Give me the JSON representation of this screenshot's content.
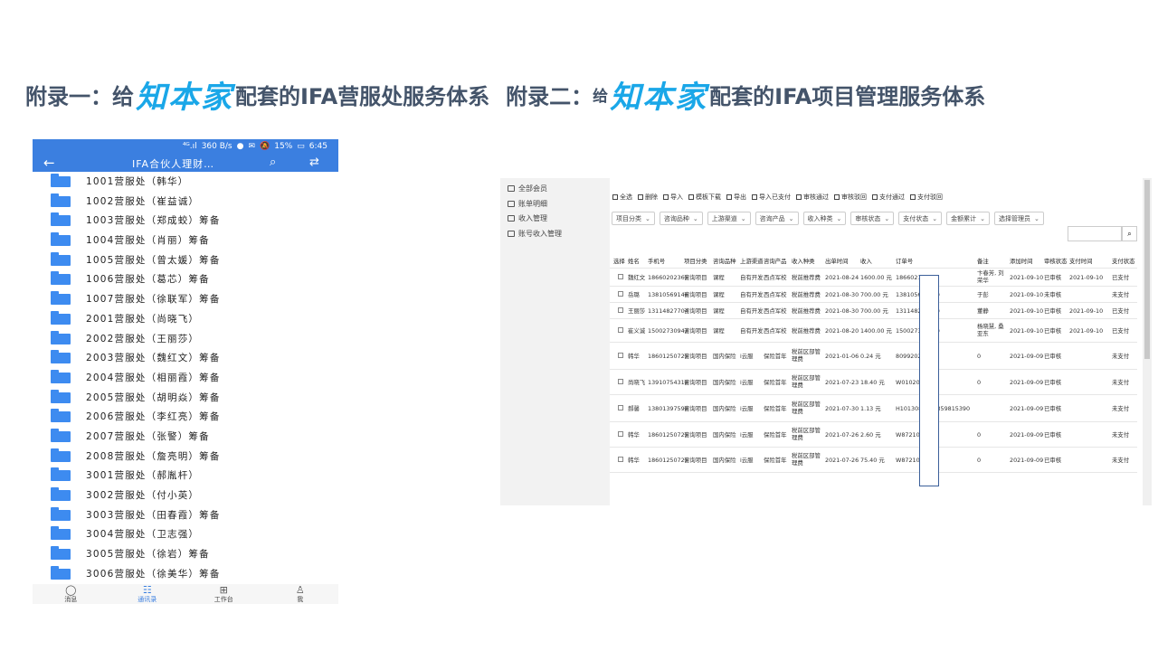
{
  "title": {
    "part1_prefix": "附录一：给",
    "brand": "知本家",
    "part1_suffix": "配套的IFA营服处服务体系",
    "part2_prefix": "附录二：",
    "part2_small": "给",
    "part2_suffix": "配套的IFA项目管理服务体系"
  },
  "colors": {
    "accent": "#3b7fe0",
    "brand": "#1aa7e8",
    "title": "#44546a",
    "folder": "#3d8bf0"
  },
  "phone": {
    "status": {
      "signal": "⁴ᴳ.ıl",
      "speed": "360 B/s",
      "battery": "15%",
      "time": "6:45"
    },
    "app_bar": {
      "title": "IFA合伙人理财…",
      "back_icon": "arrow-left-icon",
      "search_icon": "search-icon",
      "filter_icon": "filter-icon"
    },
    "folders": [
      "1001营服处（韩华）",
      "1002营服处（崔益诚）",
      "1003营服处（郑成蛟）筹备",
      "1004营服处（肖丽）筹备",
      "1005营服处（曾太媛）筹备",
      "1006营服处（葛芯）筹备",
      "1007营服处（徐联军）筹备",
      "2001营服处（尚晓飞）",
      "2002营服处（王丽莎）",
      "2003营服处（魏红文）筹备",
      "2004营服处（相丽霞）筹备",
      "2005营服处（胡明焱）筹备",
      "2006营服处（李红亮）筹备",
      "2007营服处（张警）筹备",
      "2008营服处（詹亮明）筹备",
      "3001营服处（郝胤杆）",
      "3002营服处（付小英）",
      "3003营服处（田春霞）筹备",
      "3004营服处（卫志强）",
      "3005营服处（徐岩）筹备",
      "3006营服处（徐美华）筹备"
    ],
    "nav": [
      {
        "label": "消息",
        "icon": "chat-bubble-icon",
        "active": false
      },
      {
        "label": "通讯录",
        "icon": "contacts-icon",
        "active": true
      },
      {
        "label": "工作台",
        "icon": "grid-icon",
        "active": false
      },
      {
        "label": "我",
        "icon": "person-icon",
        "active": false
      }
    ]
  },
  "desktop": {
    "sidebar": [
      "全部会员",
      "账单明细",
      "收入管理",
      "账号收入管理"
    ],
    "toolbar": [
      "全选",
      "删除",
      "导入",
      "模板下载",
      "导出",
      "导入已支付",
      "审核通过",
      "审核驳回",
      "支付通过",
      "支付驳回"
    ],
    "filters": [
      "项目分类",
      "咨询品种",
      "上游渠道",
      "咨询产品",
      "收入种类",
      "审核状态",
      "支付状态",
      "金额累计",
      "选择管理员"
    ],
    "columns": [
      "选择",
      "姓名",
      "手机号",
      "项目分类",
      "咨询品种",
      "上游渠道",
      "咨询产品",
      "收入种类",
      "出单时间",
      "收入",
      "订单号",
      "备注",
      "添加时间",
      "审核状态",
      "支付时间",
      "支付状态"
    ],
    "rows": [
      {
        "name": "魏红文",
        "phone": "18660202365",
        "cat": "咨询项目",
        "kind": "课程",
        "up": "自有开发",
        "prod": "西点军校",
        "income_type": "税前推荐费",
        "date": "2021-08-24",
        "amount": "1600.00 元",
        "order": "18660210824",
        "note": "卞春芳, 刘荣华",
        "added": "2021-09-10",
        "audit": "已审核",
        "paydate": "2021-09-10",
        "pay": "已支付"
      },
      {
        "name": "岳璐",
        "phone": "13810569146",
        "cat": "咨询项目",
        "kind": "课程",
        "up": "自有开发",
        "prod": "西点军校",
        "income_type": "税前推荐费",
        "date": "2021-08-30",
        "amount": "700.00 元",
        "order": "138105610830",
        "note": "于彭",
        "added": "2021-09-10",
        "audit": "未审核",
        "paydate": "",
        "pay": "未支付"
      },
      {
        "name": "王丽莎",
        "phone": "13114827704",
        "cat": "咨询项目",
        "kind": "课程",
        "up": "自有开发",
        "prod": "西点军校",
        "income_type": "税前推荐费",
        "date": "2021-08-30",
        "amount": "700.00 元",
        "order": "131148210830",
        "note": "董静",
        "added": "2021-09-10",
        "audit": "已审核",
        "paydate": "2021-09-10",
        "pay": "已支付"
      },
      {
        "name": "崔义诚",
        "phone": "15002730943",
        "cat": "咨询项目",
        "kind": "课程",
        "up": "自有开发",
        "prod": "西点军校",
        "income_type": "税前推荐费",
        "date": "2021-08-20",
        "amount": "1400.00 元",
        "order": "150027310820",
        "note": "杨晓慧, 桑亚东",
        "added": "2021-09-10",
        "audit": "已审核",
        "paydate": "2021-09-10",
        "pay": "已支付"
      },
      {
        "name": "韩华",
        "phone": "18601250725",
        "cat": "咨询项目",
        "kind": "国内保险",
        "up": "i云服",
        "prod": "保险首年",
        "income_type": "税前区部管理费",
        "date": "2021-01-06",
        "amount": "0.24 元",
        "order": "80992021000",
        "note": "0",
        "added": "2021-09-09",
        "audit": "已审核",
        "paydate": "",
        "pay": "未支付"
      },
      {
        "name": "尚晓飞",
        "phone": "13910754318",
        "cat": "咨询项目",
        "kind": "国内保险",
        "up": "i云服",
        "prod": "保险首年",
        "income_type": "税前区部管理费",
        "date": "2021-07-23",
        "amount": "18.40 元",
        "order": "W010209924",
        "note": "0",
        "added": "2021-09-09",
        "audit": "已审核",
        "paydate": "",
        "pay": "未支付"
      },
      {
        "name": "郝馨",
        "phone": "13801397598",
        "cat": "咨询项目",
        "kind": "国内保险",
        "up": "i云服",
        "prod": "保险首年",
        "income_type": "税前区部管理费",
        "date": "2021-07-30",
        "amount": "1.13 元",
        "order": "H1013082021359815390",
        "note": "",
        "added": "2021-09-09",
        "audit": "已审核",
        "paydate": "",
        "pay": "未支付"
      },
      {
        "name": "韩华",
        "phone": "18601250725",
        "cat": "咨询项目",
        "kind": "国内保险",
        "up": "i云服",
        "prod": "保险首年",
        "income_type": "税前区部管理费",
        "date": "2021-07-26",
        "amount": "2.60 元",
        "order": "W8721059",
        "note": "0",
        "added": "2021-09-09",
        "audit": "已审核",
        "paydate": "",
        "pay": "未支付"
      },
      {
        "name": "韩华",
        "phone": "18601250725",
        "cat": "咨询项目",
        "kind": "国内保险",
        "up": "i云服",
        "prod": "保险首年",
        "income_type": "税前区部管理费",
        "date": "2021-07-26",
        "amount": "75.40 元",
        "order": "W8721059",
        "note": "0",
        "added": "2021-09-09",
        "audit": "已审核",
        "paydate": "",
        "pay": "未支付"
      }
    ]
  }
}
